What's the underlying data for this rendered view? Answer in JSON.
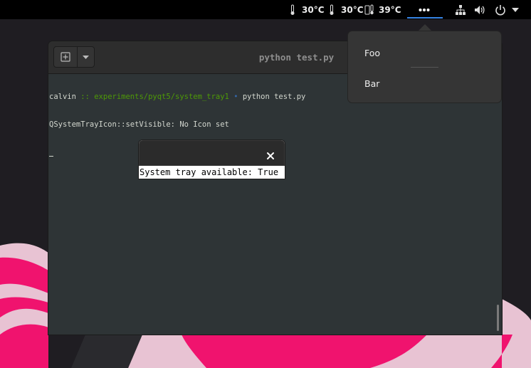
{
  "colors": {
    "desktop_bg": "#1f1d22",
    "accent": "#3584e4",
    "terminal_bg": "#2e3436",
    "headerbar_bg": "#2d2d2d",
    "popover_bg": "#353535",
    "wallpaper_pink": "#e8c3d3",
    "wallpaper_magenta": "#f0136e"
  },
  "topbar": {
    "sensors": [
      {
        "icon": "thermometer-icon",
        "value": "30°C"
      },
      {
        "icon": "thermometer-icon",
        "value": "30°C"
      },
      {
        "icon": "drive-thermometer-icon",
        "value": "39°C"
      }
    ],
    "overflow_icon": "more-horizontal-icon",
    "status_icons": [
      "network-icon",
      "volume-icon",
      "power-icon",
      "chevron-down-icon"
    ]
  },
  "tray_menu": {
    "items": [
      {
        "label": "Foo"
      },
      {
        "label": "Bar"
      }
    ]
  },
  "terminal": {
    "title": "python test.py",
    "prompt": {
      "user": "calvin",
      "sep": " :: ",
      "path": "experiments/pyqt5/system_tray1",
      "dot": " • ",
      "command": "python test.py"
    },
    "output": "QSystemTrayIcon::setVisible: No Icon set",
    "cursor": "_"
  },
  "dialog": {
    "label": "System tray available: True",
    "close_icon": "close-icon"
  }
}
